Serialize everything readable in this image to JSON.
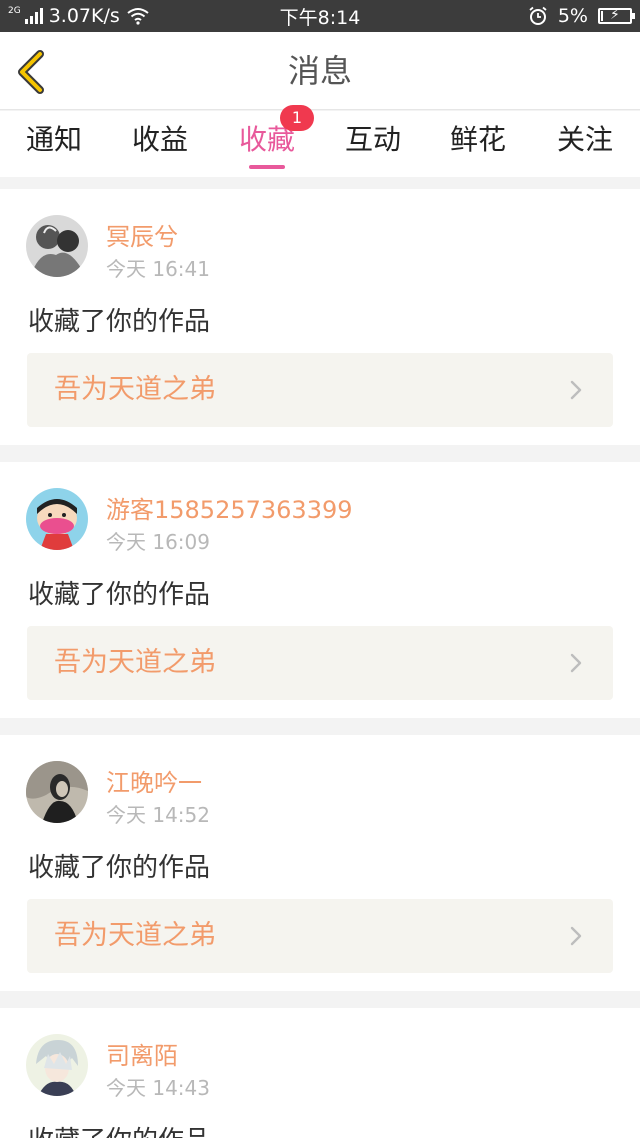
{
  "status_bar": {
    "network_type": "2G",
    "speed": "3.07K/s",
    "time": "下午8:14",
    "battery": "5%",
    "icons": [
      "signal-icon",
      "wifi-icon",
      "alarm-icon",
      "battery-charging-icon"
    ]
  },
  "header": {
    "title": "消息",
    "back_icon": "chevron-left-icon"
  },
  "tabs": [
    {
      "label": "通知",
      "active": false
    },
    {
      "label": "收益",
      "active": false
    },
    {
      "label": "收藏",
      "active": true,
      "badge": "1"
    },
    {
      "label": "互动",
      "active": false
    },
    {
      "label": "鲜花",
      "active": false
    },
    {
      "label": "关注",
      "active": false
    }
  ],
  "feed": [
    {
      "username": "冥辰兮",
      "time": "今天 16:41",
      "action": "收藏了你的作品",
      "work_title": "吾为天道之弟"
    },
    {
      "username": "游客1585257363399",
      "time": "今天 16:09",
      "action": "收藏了你的作品",
      "work_title": "吾为天道之弟"
    },
    {
      "username": "江晚吟一",
      "time": "今天 14:52",
      "action": "收藏了你的作品",
      "work_title": "吾为天道之弟"
    },
    {
      "username": "司离陌",
      "time": "今天 14:43",
      "action": "收藏了你的作品",
      "work_title": ""
    }
  ],
  "colors": {
    "accent_pink": "#e8599b",
    "badge_red": "#f0394f",
    "name_orange": "#f29b6b",
    "back_yellow": "#f5c400"
  }
}
